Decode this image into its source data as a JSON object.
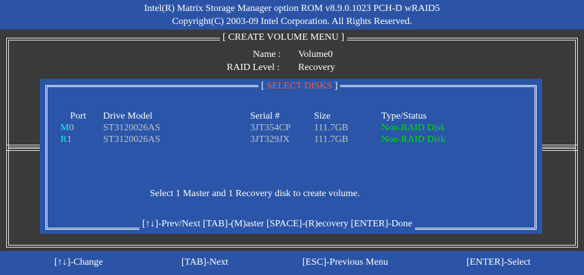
{
  "header": {
    "line1": "Intel(R) Matrix Storage Manager option ROM v8.9.0.1023 PCH-D wRAID5",
    "line2": "Copyright(C) 2003-09 Intel Corporation.  All Rights Reserved."
  },
  "create_menu": {
    "title": "[ CREATE VOLUME MENU ]",
    "name_label": "Name :",
    "name_value": "Volume0",
    "raid_label": "RAID Level :",
    "raid_value": "Recovery"
  },
  "select_disks": {
    "title_open": "[ ",
    "title": "SELECT DISKS",
    "title_close": " ]",
    "columns": [
      "Port",
      "Drive Model",
      "Serial #",
      "Size",
      "Type/Status"
    ],
    "rows": [
      {
        "flag": "M",
        "port": "0",
        "model": "ST3120026AS",
        "serial": "3JT354CP",
        "size": "111.7GB",
        "status": "Non-RAID Disk"
      },
      {
        "flag": "R",
        "port": "1",
        "model": "ST3120026AS",
        "serial": "3JT329JX",
        "size": "111.7GB",
        "status": "Non-RAID Disk"
      }
    ],
    "instruction": "Select 1 Master and 1 Recovery disk to create volume.",
    "help": "[↑↓]-Prev/Next  [TAB]-(M)aster  [SPACE]-(R)ecovery  [ENTER]-Done"
  },
  "footer": {
    "change": "[↑↓]-Change",
    "next": "[TAB]-Next",
    "previous": "[ESC]-Previous Menu",
    "select": "[ENTER]-Select"
  },
  "colors": {
    "blue": "#2c54a6",
    "gray": "#3a3a3a",
    "title_red": "#ff5a3c",
    "status_green": "#00e000",
    "key_cyan": "#00ffe4"
  }
}
